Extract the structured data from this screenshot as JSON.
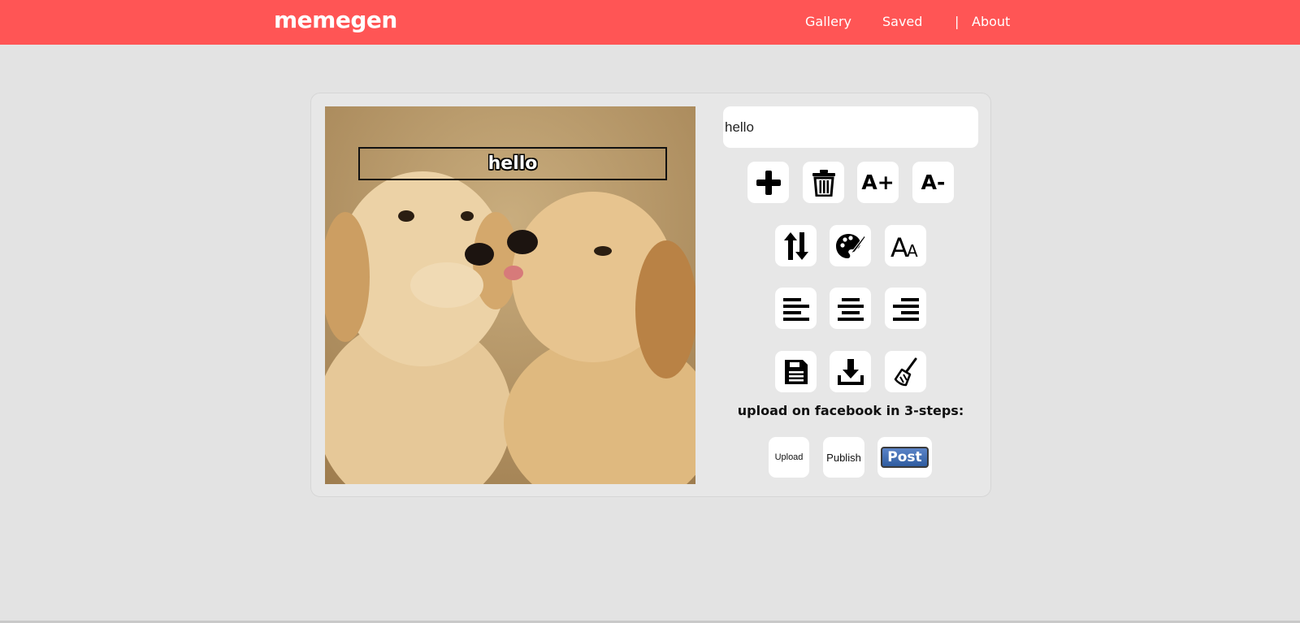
{
  "app": {
    "logo": "memegen"
  },
  "nav": {
    "gallery": "Gallery",
    "saved": "Saved",
    "separator": "|",
    "about": "About"
  },
  "meme": {
    "line_text": "hello"
  },
  "editor": {
    "text_value": "hello"
  },
  "tools": {
    "row1": [
      "add-line",
      "delete-line",
      "increase-font",
      "decrease-font"
    ],
    "increase_label": "A+",
    "decrease_label": "A-"
  },
  "facebook": {
    "title": "upload on facebook in 3-steps:",
    "upload": "Upload",
    "publish": "Publish",
    "post": "Post"
  },
  "colors": {
    "topbar": "#ff5555",
    "background": "#e3e3e3",
    "button_bg": "#ffffff",
    "post_blue": "#3b6aa8"
  }
}
